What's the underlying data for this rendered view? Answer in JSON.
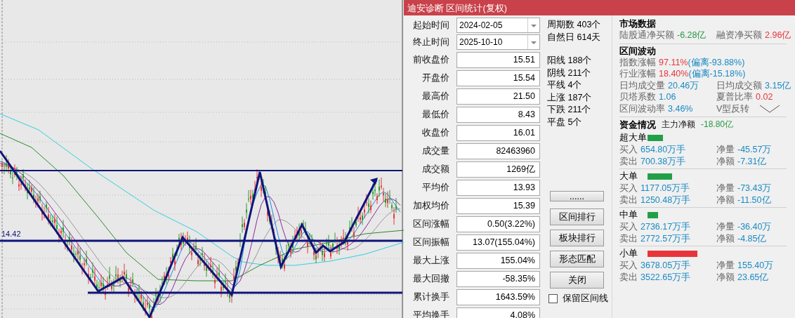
{
  "chart": {
    "price_label": "14.42"
  },
  "panel": {
    "title": "迪安诊断 区间统计(复权)",
    "date_fields": [
      {
        "label": "起始时间",
        "value": "2024-02-05"
      },
      {
        "label": "终止时间",
        "value": "2025-10-10"
      }
    ],
    "fields": [
      {
        "label": "前收盘价",
        "value": "15.51"
      },
      {
        "label": "开盘价",
        "value": "15.54"
      },
      {
        "label": "最高价",
        "value": "21.50"
      },
      {
        "label": "最低价",
        "value": "8.43"
      },
      {
        "label": "收盘价",
        "value": "16.01"
      },
      {
        "label": "成交量",
        "value": "82463960"
      },
      {
        "label": "成交额",
        "value": "1269亿"
      },
      {
        "label": "平均价",
        "value": "13.93"
      },
      {
        "label": "加权均价",
        "value": "15.39"
      },
      {
        "label": "区间涨幅",
        "value": "0.50(3.22%)"
      },
      {
        "label": "区间振幅",
        "value": "13.07(155.04%)"
      },
      {
        "label": "最大上涨",
        "value": "155.04%"
      },
      {
        "label": "最大回撤",
        "value": "-58.35%"
      },
      {
        "label": "累计换手",
        "value": "1643.59%"
      },
      {
        "label": "平均换手",
        "value": "4.08%"
      }
    ],
    "period_stats": [
      "周期数 403个",
      "自然日 614天"
    ],
    "candle_stats": [
      "阳线 188个",
      "阴线 211个",
      "平线 4个",
      "上涨 187个",
      "下跌 211个",
      "平盘 5个"
    ],
    "buttons": [
      "......",
      "区间排行",
      "板块排行",
      "形态匹配",
      "关闭"
    ],
    "keep_lines": {
      "label": "保留区间线",
      "checked": false
    },
    "market": {
      "title": "市场数据",
      "items": [
        {
          "label": "陆股通净买额",
          "value": "-6.28亿",
          "color": "#279a45"
        },
        {
          "label": "融资净买额",
          "value": "2.96亿",
          "color": "#e8353b"
        }
      ]
    },
    "volatility": {
      "title": "区间波动",
      "rows": [
        {
          "cells": [
            {
              "kind": "stat",
              "label": "指数涨幅",
              "values": [
                {
                  "text": "97.11%",
                  "color": "#e8353b"
                },
                {
                  "text": "(偏离-93.88%)",
                  "color": "#1a8ac4"
                }
              ]
            }
          ]
        },
        {
          "cells": [
            {
              "kind": "stat",
              "label": "行业涨幅",
              "values": [
                {
                  "text": "18.40%",
                  "color": "#e8353b"
                },
                {
                  "text": "(偏离-15.18%)",
                  "color": "#1a8ac4"
                }
              ]
            }
          ]
        },
        {
          "cells": [
            {
              "kind": "stat",
              "label": "日均成交量",
              "values": [
                {
                  "text": "20.46万",
                  "color": "#1a8ac4"
                }
              ]
            },
            {
              "kind": "stat",
              "label": "日均成交额",
              "values": [
                {
                  "text": "3.15亿",
                  "color": "#1a8ac4"
                }
              ]
            }
          ]
        },
        {
          "cells": [
            {
              "kind": "stat",
              "label": "贝塔系数",
              "values": [
                {
                  "text": "1.06",
                  "color": "#1a8ac4"
                }
              ]
            },
            {
              "kind": "stat",
              "label": "夏普比率",
              "values": [
                {
                  "text": "0.02",
                  "color": "#e8353b"
                }
              ]
            }
          ]
        },
        {
          "cells": [
            {
              "kind": "stat",
              "label": "区间波动率",
              "values": [
                {
                  "text": "3.46%",
                  "color": "#1a8ac4"
                }
              ]
            },
            {
              "kind": "pattern",
              "label": "V型反转"
            }
          ]
        }
      ]
    },
    "funds": {
      "title": "资金情况",
      "main_label": "主力净额",
      "main_value": "-18.80亿",
      "groups": [
        {
          "name": "超大单",
          "color": "#22a049",
          "items": [
            {
              "label": "买入",
              "value": "654.80万手"
            },
            {
              "label": "净量",
              "value": "-45.57万"
            },
            {
              "label": "卖出",
              "value": "700.38万手"
            },
            {
              "label": "净额",
              "value": "-7.31亿"
            }
          ]
        },
        {
          "name": "大单",
          "color": "#22a049",
          "items": [
            {
              "label": "买入",
              "value": "1177.05万手"
            },
            {
              "label": "净量",
              "value": "-73.43万"
            },
            {
              "label": "卖出",
              "value": "1250.48万手"
            },
            {
              "label": "净额",
              "value": "-11.50亿"
            }
          ]
        },
        {
          "name": "中单",
          "color": "#22a049",
          "items": [
            {
              "label": "买入",
              "value": "2736.17万手"
            },
            {
              "label": "净量",
              "value": "-36.40万"
            },
            {
              "label": "卖出",
              "value": "2772.57万手"
            },
            {
              "label": "净额",
              "value": "-4.85亿"
            }
          ]
        },
        {
          "name": "小单",
          "color": "#e8353b",
          "items": [
            {
              "label": "买入",
              "value": "3678.05万手"
            },
            {
              "label": "净量",
              "value": "155.40万"
            },
            {
              "label": "卖出",
              "value": "3522.65万手"
            },
            {
              "label": "净额",
              "value": "23.65亿"
            }
          ]
        }
      ]
    }
  }
}
